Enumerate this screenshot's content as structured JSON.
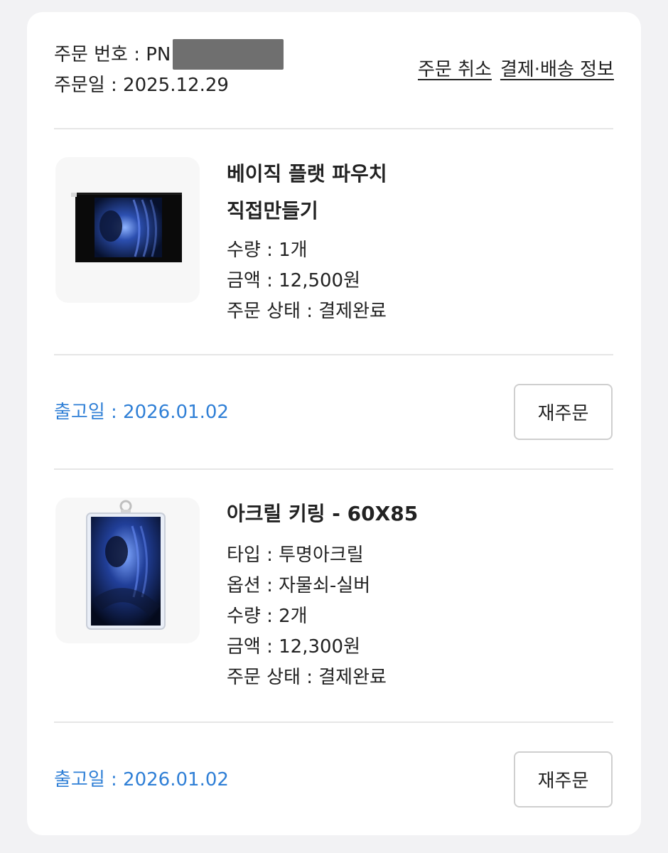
{
  "order": {
    "number_label": "주문 번호 : PN",
    "date_label": "주문일 : 2025.12.29",
    "cancel_link": "주문 취소",
    "payment_shipping_link": "결제·배송 정보"
  },
  "items": [
    {
      "name_line1": "베이직 플랫 파우치",
      "name_line2": "직접만들기",
      "details": [
        "수량 : 1개",
        "금액 : 12,500원",
        "주문 상태 : 결제완료"
      ],
      "ship_date": "출고일 : 2026.01.02",
      "reorder_label": "재주문"
    },
    {
      "name_line1": "아크릴 키링 - 60X85",
      "details": [
        "타입 : 투명아크릴",
        "옵션 : 자물쇠-실버",
        "수량 : 2개",
        "금액 : 12,300원",
        "주문 상태 : 결제완료"
      ],
      "ship_date": "출고일 : 2026.01.02",
      "reorder_label": "재주문"
    }
  ],
  "colors": {
    "ship_date_text": "#2f7fd6",
    "page_background": "#f2f2f4",
    "card_background": "#ffffff"
  }
}
